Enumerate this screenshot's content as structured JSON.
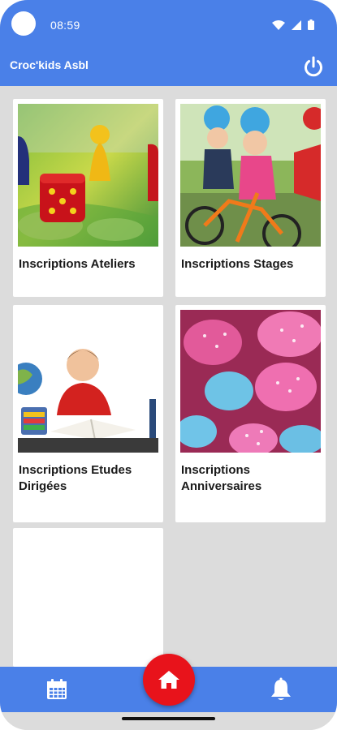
{
  "status_bar": {
    "time": "08:59"
  },
  "app_bar": {
    "title": "Croc'kids Asbl"
  },
  "cards": [
    {
      "label": "Inscriptions Ateliers"
    },
    {
      "label": "Inscriptions Stages"
    },
    {
      "label": "Inscriptions Etudes Dirigées"
    },
    {
      "label": "Inscriptions Anniversaires"
    },
    {
      "label": ""
    }
  ],
  "bottom_nav": {
    "items": [
      {
        "icon": "calendar-icon"
      },
      {
        "icon": "home-icon"
      },
      {
        "icon": "bell-icon"
      }
    ]
  },
  "colors": {
    "primary": "#4a80e8",
    "fab": "#e8131b",
    "background": "#dcdcdc",
    "card": "#ffffff"
  }
}
